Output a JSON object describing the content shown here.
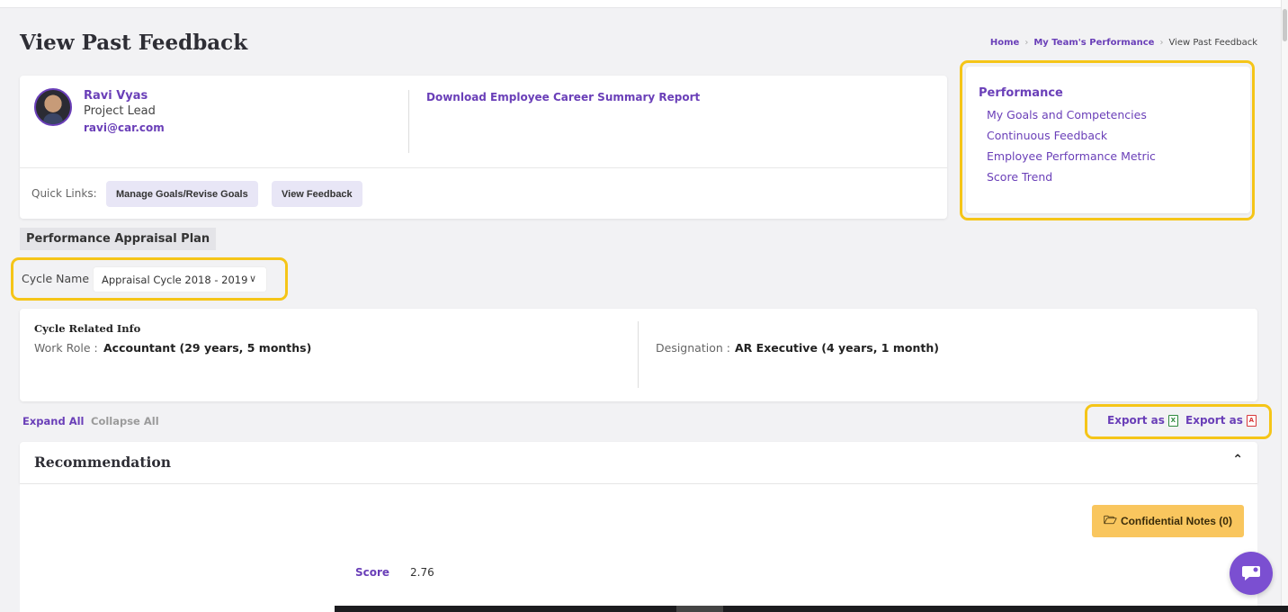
{
  "page": {
    "title": "View Past Feedback"
  },
  "breadcrumb": {
    "home": "Home",
    "section": "My Team's Performance",
    "current": "View Past Feedback"
  },
  "employee": {
    "name": "Ravi Vyas",
    "role": "Project Lead",
    "email": "ravi@car.com",
    "download_link": "Download Employee Career Summary Report"
  },
  "quick_links": {
    "label": "Quick Links:",
    "buttons": [
      "Manage Goals/Revise Goals",
      "View Feedback"
    ]
  },
  "performance_menu": {
    "title": "Performance",
    "links": [
      "My Goals and Competencies",
      "Continuous Feedback",
      "Employee Performance Metric",
      "Score Trend"
    ]
  },
  "appraisal_plan": {
    "tag": "Performance Appraisal Plan",
    "cycle_label": "Cycle Name",
    "cycle_value": "Appraisal Cycle 2018 - 2019"
  },
  "cycle_info": {
    "heading": "Cycle Related Info",
    "work_role_label": "Work Role :",
    "work_role_value": "Accountant (29 years, 5 months)",
    "designation_label": "Designation :",
    "designation_value": "AR Executive (4 years, 1 month)"
  },
  "toolbar": {
    "expand_all": "Expand All",
    "collapse_all": "Collapse All",
    "export_label": "Export as"
  },
  "recommendation": {
    "title": "Recommendation",
    "confidential_notes": "Confidential Notes (0)",
    "score_label": "Score",
    "score_value": "2.76"
  },
  "colors": {
    "accent": "#6a3fb8",
    "highlight": "#f5c518",
    "notes_button": "#f9c65e",
    "chat_fab": "#7b4fd1"
  },
  "icons": [
    "chevron-right-icon",
    "chevron-down-icon",
    "chevron-up-icon",
    "excel-file-icon",
    "pdf-file-icon",
    "folder-icon",
    "chat-icon"
  ]
}
